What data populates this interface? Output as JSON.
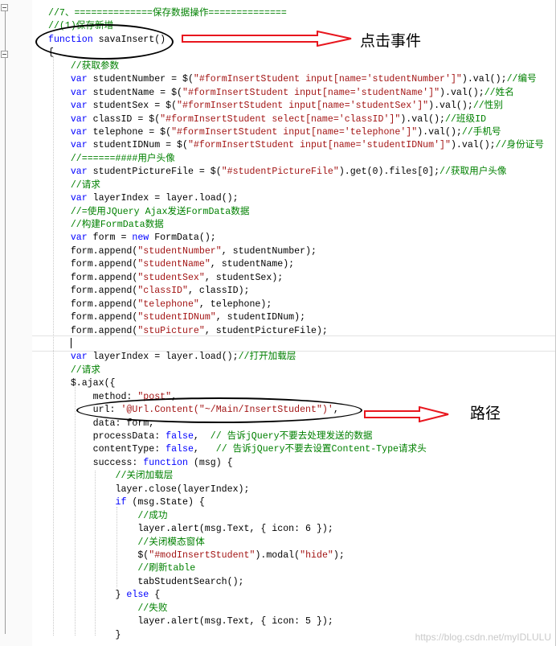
{
  "lines": [
    [
      {
        "t": "//7、==============保存数据操作==============",
        "c": "cm"
      }
    ],
    [
      {
        "t": "//(1)保存新增",
        "c": "cm"
      }
    ],
    [
      {
        "t": "function",
        "c": "kw"
      },
      {
        "t": " savaInsert()"
      }
    ],
    [
      {
        "t": "{"
      }
    ],
    [
      {
        "t": "    //获取参数",
        "c": "cm"
      }
    ],
    [
      {
        "t": "    "
      },
      {
        "t": "var",
        "c": "kw"
      },
      {
        "t": " studentNumber = $("
      },
      {
        "t": "\"#formInsertStudent input[name='studentNumber']\"",
        "c": "st"
      },
      {
        "t": ").val();"
      },
      {
        "t": "//编号",
        "c": "cm"
      }
    ],
    [
      {
        "t": "    "
      },
      {
        "t": "var",
        "c": "kw"
      },
      {
        "t": " studentName = $("
      },
      {
        "t": "\"#formInsertStudent input[name='studentName']\"",
        "c": "st"
      },
      {
        "t": ").val();"
      },
      {
        "t": "//姓名",
        "c": "cm"
      }
    ],
    [
      {
        "t": "    "
      },
      {
        "t": "var",
        "c": "kw"
      },
      {
        "t": " studentSex = $("
      },
      {
        "t": "\"#formInsertStudent input[name='studentSex']\"",
        "c": "st"
      },
      {
        "t": ").val();"
      },
      {
        "t": "//性别",
        "c": "cm"
      }
    ],
    [
      {
        "t": "    "
      },
      {
        "t": "var",
        "c": "kw"
      },
      {
        "t": " classID = $("
      },
      {
        "t": "\"#formInsertStudent select[name='classID']\"",
        "c": "st"
      },
      {
        "t": ").val();"
      },
      {
        "t": "//班级ID",
        "c": "cm"
      }
    ],
    [
      {
        "t": "    "
      },
      {
        "t": "var",
        "c": "kw"
      },
      {
        "t": " telephone = $("
      },
      {
        "t": "\"#formInsertStudent input[name='telephone']\"",
        "c": "st"
      },
      {
        "t": ").val();"
      },
      {
        "t": "//手机号",
        "c": "cm"
      }
    ],
    [
      {
        "t": "    "
      },
      {
        "t": "var",
        "c": "kw"
      },
      {
        "t": " studentIDNum = $("
      },
      {
        "t": "\"#formInsertStudent input[name='studentIDNum']\"",
        "c": "st"
      },
      {
        "t": ").val();"
      },
      {
        "t": "//身份证号",
        "c": "cm"
      }
    ],
    [
      {
        "t": "    //======####用户头像",
        "c": "cm"
      }
    ],
    [
      {
        "t": "    "
      },
      {
        "t": "var",
        "c": "kw"
      },
      {
        "t": " studentPictureFile = $("
      },
      {
        "t": "\"#studentPictureFile\"",
        "c": "st"
      },
      {
        "t": ").get(0).files[0];"
      },
      {
        "t": "//获取用户头像",
        "c": "cm"
      }
    ],
    [
      {
        "t": "    //请求",
        "c": "cm"
      }
    ],
    [
      {
        "t": "    "
      },
      {
        "t": "var",
        "c": "kw"
      },
      {
        "t": " layerIndex = layer.load();"
      }
    ],
    [
      {
        "t": "    //=使用JQuery Ajax发送FormData数据",
        "c": "cm"
      }
    ],
    [
      {
        "t": "    //构建FormData数据",
        "c": "cm"
      }
    ],
    [
      {
        "t": "    "
      },
      {
        "t": "var",
        "c": "kw"
      },
      {
        "t": " form = "
      },
      {
        "t": "new",
        "c": "kw"
      },
      {
        "t": " FormData();"
      }
    ],
    [
      {
        "t": "    form.append("
      },
      {
        "t": "\"studentNumber\"",
        "c": "st"
      },
      {
        "t": ", studentNumber);"
      }
    ],
    [
      {
        "t": "    form.append("
      },
      {
        "t": "\"studentName\"",
        "c": "st"
      },
      {
        "t": ", studentName);"
      }
    ],
    [
      {
        "t": "    form.append("
      },
      {
        "t": "\"studentSex\"",
        "c": "st"
      },
      {
        "t": ", studentSex);"
      }
    ],
    [
      {
        "t": "    form.append("
      },
      {
        "t": "\"classID\"",
        "c": "st"
      },
      {
        "t": ", classID);"
      }
    ],
    [
      {
        "t": "    form.append("
      },
      {
        "t": "\"telephone\"",
        "c": "st"
      },
      {
        "t": ", telephone);"
      }
    ],
    [
      {
        "t": "    form.append("
      },
      {
        "t": "\"studentIDNum\"",
        "c": "st"
      },
      {
        "t": ", studentIDNum);"
      }
    ],
    [
      {
        "t": "    form.append("
      },
      {
        "t": "\"stuPicture\"",
        "c": "st"
      },
      {
        "t": ", studentPictureFile);"
      }
    ],
    [
      {
        "t": "    "
      }
    ],
    [
      {
        "t": "    "
      },
      {
        "t": "var",
        "c": "kw"
      },
      {
        "t": " layerIndex = layer.load();"
      },
      {
        "t": "//打开加载层",
        "c": "cm"
      }
    ],
    [
      {
        "t": "    //请求",
        "c": "cm"
      }
    ],
    [
      {
        "t": "    $.ajax({"
      }
    ],
    [
      {
        "t": "        method: "
      },
      {
        "t": "\"post\"",
        "c": "st"
      },
      {
        "t": ","
      }
    ],
    [
      {
        "t": "        url: "
      },
      {
        "t": "'@Url.Content(\"~/Main/InsertStudent\")'",
        "c": "st"
      },
      {
        "t": ","
      }
    ],
    [
      {
        "t": "        data: form,"
      }
    ],
    [
      {
        "t": "        processData: "
      },
      {
        "t": "false",
        "c": "kw"
      },
      {
        "t": ",  "
      },
      {
        "t": "// 告诉jQuery不要去处理发送的数据",
        "c": "cm"
      }
    ],
    [
      {
        "t": "        contentType: "
      },
      {
        "t": "false",
        "c": "kw"
      },
      {
        "t": ",   "
      },
      {
        "t": "// 告诉jQuery不要去设置Content-Type请求头",
        "c": "cm"
      }
    ],
    [
      {
        "t": "        success: "
      },
      {
        "t": "function",
        "c": "kw"
      },
      {
        "t": " (msg) {"
      }
    ],
    [
      {
        "t": "            //关闭加载层",
        "c": "cm"
      }
    ],
    [
      {
        "t": "            layer.close(layerIndex);"
      }
    ],
    [
      {
        "t": "            "
      },
      {
        "t": "if",
        "c": "kw"
      },
      {
        "t": " (msg.State) {"
      }
    ],
    [
      {
        "t": "                //成功",
        "c": "cm"
      }
    ],
    [
      {
        "t": "                layer.alert(msg.Text, { icon: 6 });"
      }
    ],
    [
      {
        "t": "                //关闭模态窗体",
        "c": "cm"
      }
    ],
    [
      {
        "t": "                $("
      },
      {
        "t": "\"#modInsertStudent\"",
        "c": "st"
      },
      {
        "t": ").modal("
      },
      {
        "t": "\"hide\"",
        "c": "st"
      },
      {
        "t": ");"
      }
    ],
    [
      {
        "t": "                //刷新table",
        "c": "cm"
      }
    ],
    [
      {
        "t": "                tabStudentSearch();"
      }
    ],
    [
      {
        "t": "            } "
      },
      {
        "t": "else",
        "c": "kw"
      },
      {
        "t": " {"
      }
    ],
    [
      {
        "t": "                //失败",
        "c": "cm"
      }
    ],
    [
      {
        "t": "                layer.alert(msg.Text, { icon: 5 });"
      }
    ],
    [
      {
        "t": "            }"
      }
    ]
  ],
  "annotations": {
    "click_event": "点击事件",
    "path": "路径"
  },
  "watermark": "https://blog.csdn.net/myIDLULU",
  "colors": {
    "keyword": "#0000ff",
    "comment": "#008000",
    "string": "#a31515",
    "arrow": "#e8161e"
  }
}
